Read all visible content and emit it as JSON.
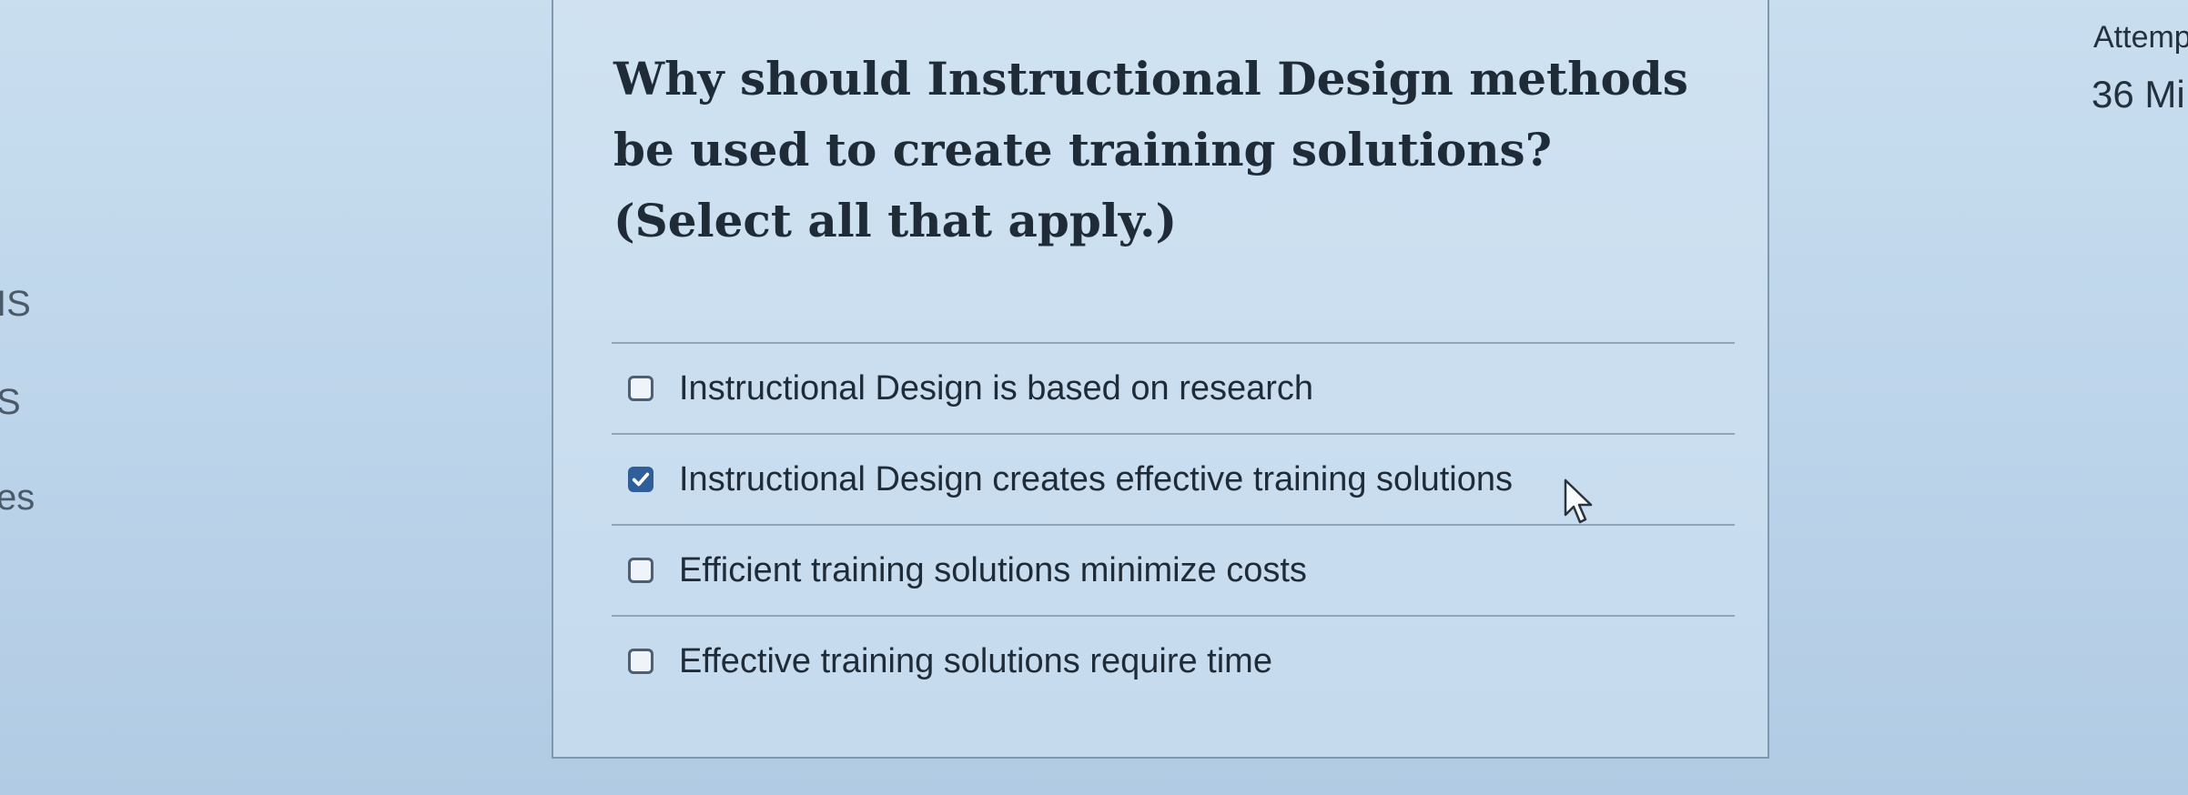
{
  "sidebar": {
    "fragments": [
      "IS",
      "S",
      "es"
    ]
  },
  "question": {
    "text": "Why should Instructional Design methods be used to create training solutions? (Select all that apply.)",
    "answers": [
      {
        "label": "Instructional Design is based on research",
        "checked": false
      },
      {
        "label": "Instructional Design creates effective training solutions",
        "checked": true
      },
      {
        "label": "Efficient training solutions minimize costs",
        "checked": false
      },
      {
        "label": "Effective training solutions require time",
        "checked": false
      }
    ]
  },
  "attempt": {
    "label": "Attemp",
    "value": "36 Mi"
  },
  "colors": {
    "accent": "#2f5f9a",
    "background": "#bcd4ea"
  }
}
